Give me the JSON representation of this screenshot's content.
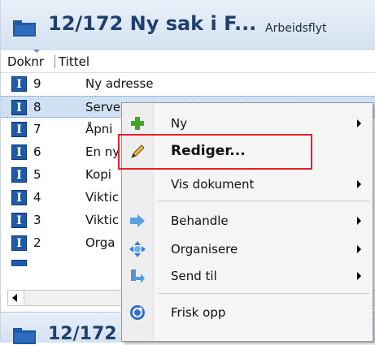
{
  "header": {
    "title": "12/172 Ny sak i F...",
    "subtitle": "Arbeidsflyt"
  },
  "columns": {
    "doknr": "Doknr",
    "tittel": "Tittel"
  },
  "rows": [
    {
      "badge": "I",
      "nr": "9",
      "title": "Ny adresse"
    },
    {
      "badge": "I",
      "nr": "8",
      "title": "Serve"
    },
    {
      "badge": "I",
      "nr": "7",
      "title": "Åpni"
    },
    {
      "badge": "I",
      "nr": "6",
      "title": "En ny"
    },
    {
      "badge": "I",
      "nr": "5",
      "title": "Kopi"
    },
    {
      "badge": "I",
      "nr": "4",
      "title": "Viktic"
    },
    {
      "badge": "I",
      "nr": "3",
      "title": "Viktic"
    },
    {
      "badge": "I",
      "nr": "2",
      "title": "Orga"
    }
  ],
  "second_panel": {
    "title": "12/172"
  },
  "context_menu": {
    "items": [
      {
        "label": "Ny",
        "icon": "plus-icon",
        "submenu": true
      },
      {
        "label": "Rediger...",
        "icon": "pencil-icon",
        "submenu": false
      },
      {
        "label": "Vis dokument",
        "icon": "",
        "submenu": true
      },
      {
        "label": "Behandle",
        "icon": "arrow-right-icon",
        "submenu": true
      },
      {
        "label": "Organisere",
        "icon": "move-icon",
        "submenu": true
      },
      {
        "label": "Send til",
        "icon": "send-icon",
        "submenu": true
      },
      {
        "label": "Frisk opp",
        "icon": "refresh-icon",
        "submenu": false
      }
    ]
  },
  "colors": {
    "badge": "#1f5aa6",
    "highlight": "#e8202a",
    "header_text": "#1f3f6e"
  }
}
